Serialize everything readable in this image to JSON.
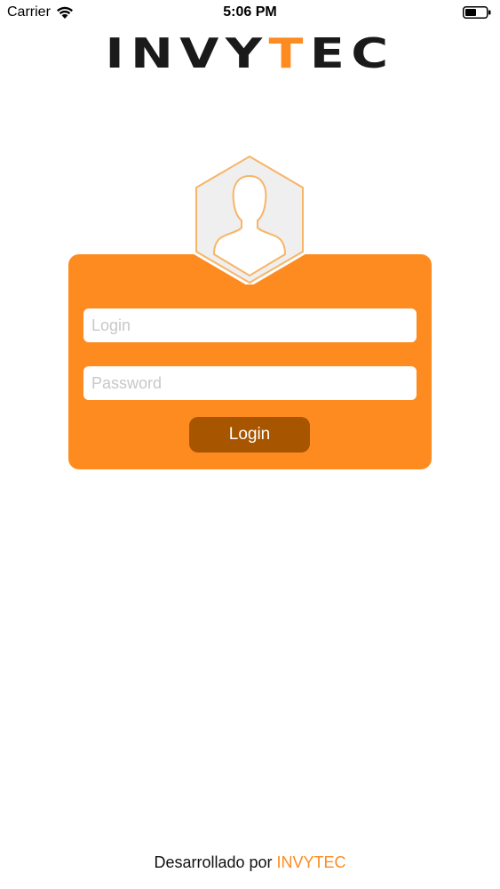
{
  "status_bar": {
    "carrier": "Carrier",
    "time": "5:06 PM"
  },
  "logo": {
    "text_part1": "INVY",
    "text_accent": "T",
    "text_part2": "EC",
    "accent_color": "#fd8b20"
  },
  "avatar": {
    "icon": "user-silhouette-icon"
  },
  "form": {
    "login_placeholder": "Login",
    "login_value": "",
    "password_placeholder": "Password",
    "password_value": "",
    "submit_label": "Login",
    "card_color": "#fd8b20",
    "button_color": "#a85500"
  },
  "footer": {
    "prefix": "Desarrollado por ",
    "brand": "INVYTEC"
  }
}
